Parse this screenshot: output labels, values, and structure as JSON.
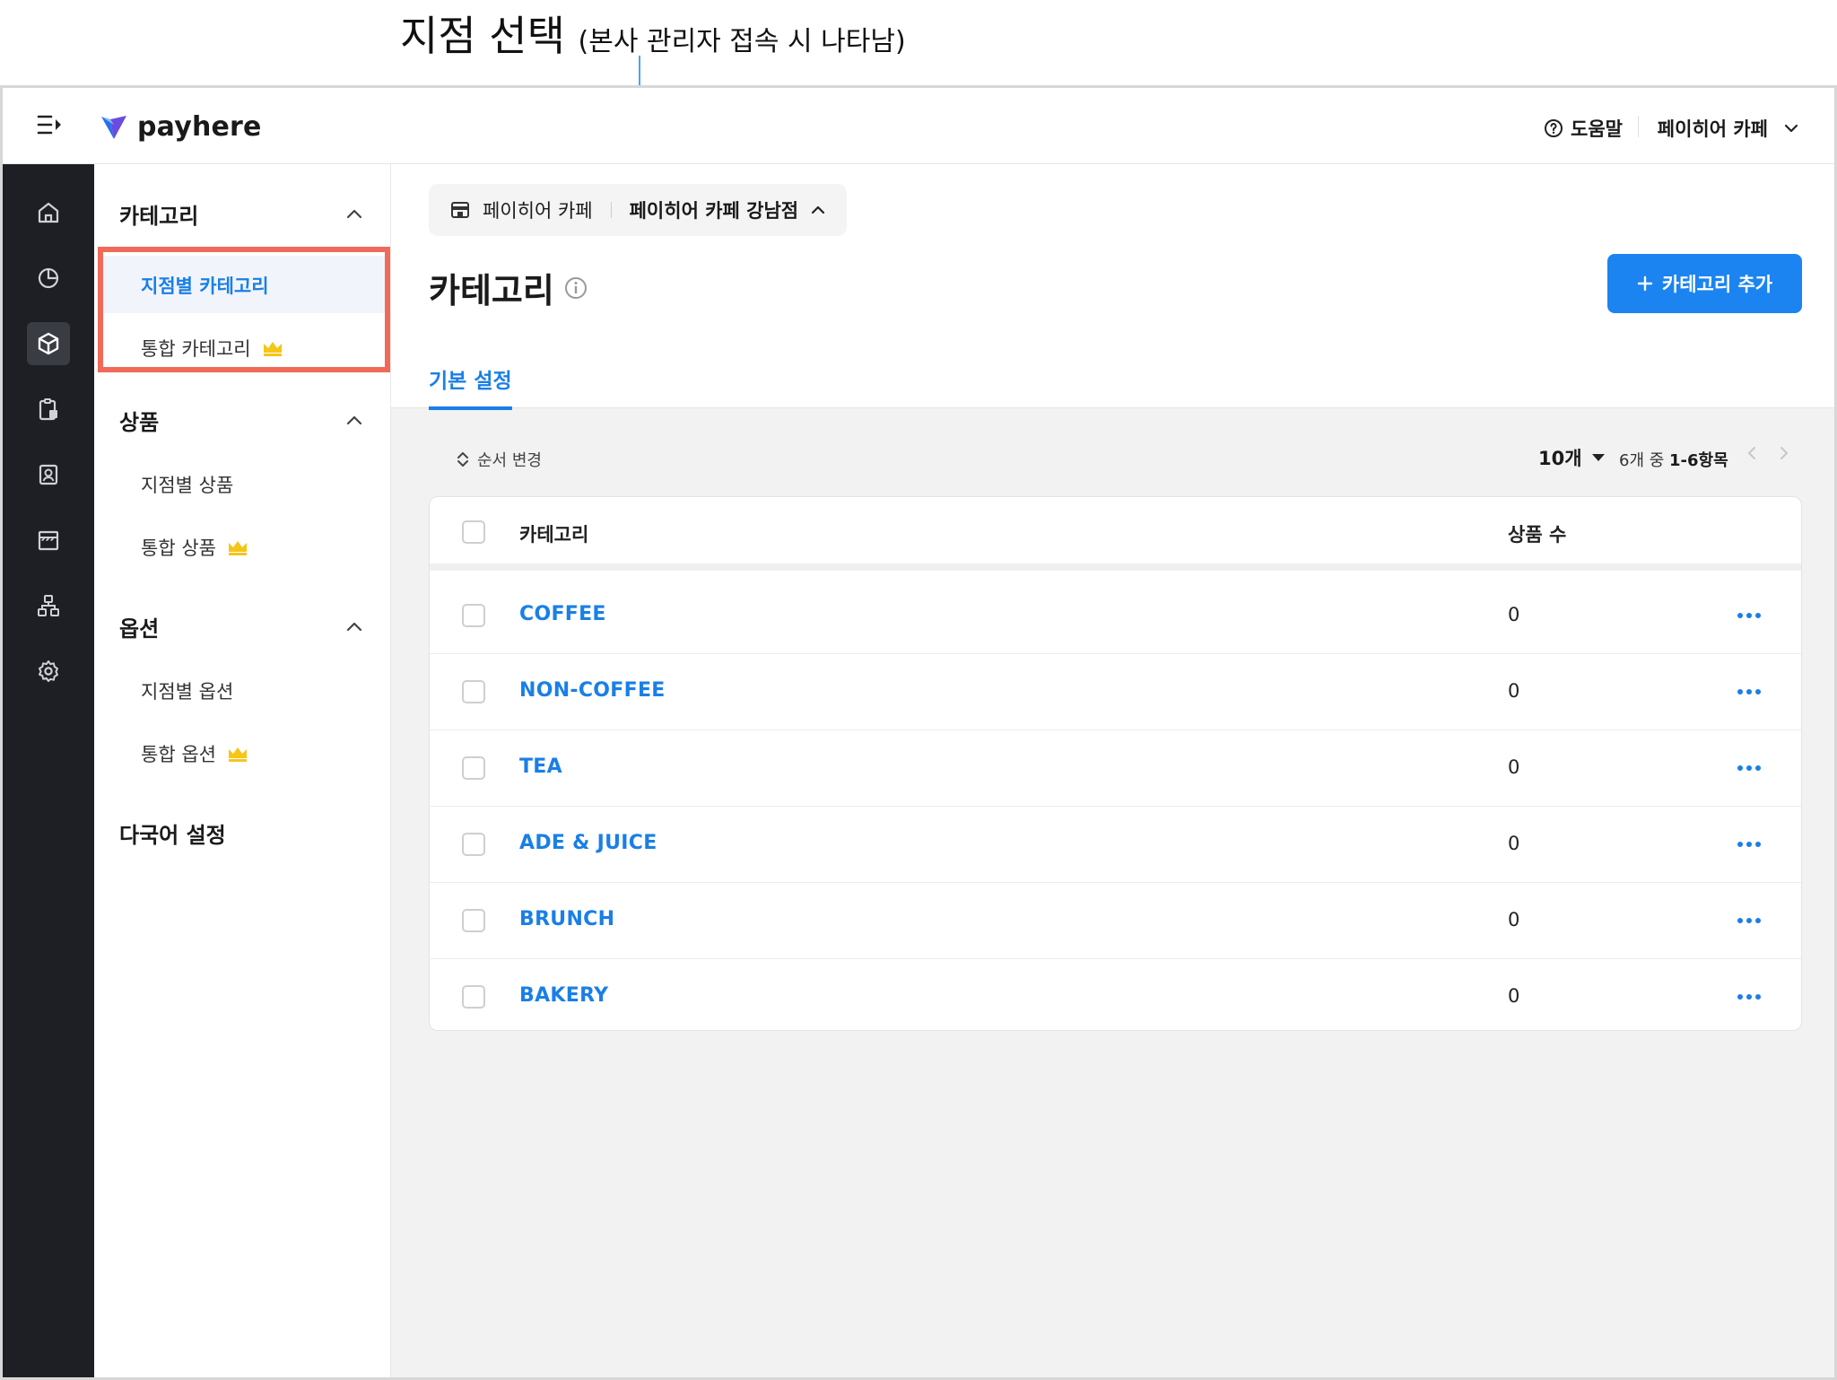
{
  "annotation": {
    "title": "지점 선택",
    "subtitle": "(본사 관리자 접속 시 나타남)"
  },
  "topbar": {
    "logo_text": "payhere",
    "help_label": "도움말",
    "account_label": "페이히어 카페",
    "icons": [
      "menu-collapse-icon",
      "help-circle-icon",
      "chevron-down-icon"
    ]
  },
  "rail": {
    "icons": [
      "home-icon",
      "chart-pie-icon",
      "box-icon",
      "clipboard-icon",
      "user-card-icon",
      "store-icon",
      "hierarchy-icon",
      "gear-icon"
    ],
    "active_index": 2
  },
  "subnav": {
    "sections": [
      {
        "title": "카테고리",
        "items": [
          {
            "label": "지점별 카테고리",
            "active": true
          },
          {
            "label": "통합 카테고리",
            "crown": true
          }
        ]
      },
      {
        "title": "상품",
        "items": [
          {
            "label": "지점별 상품"
          },
          {
            "label": "통합 상품",
            "crown": true
          }
        ]
      },
      {
        "title": "옵션",
        "items": [
          {
            "label": "지점별 옵션"
          },
          {
            "label": "통합 옵션",
            "crown": true
          }
        ]
      }
    ],
    "extra": "다국어 설정"
  },
  "branch_selector": {
    "brand": "페이히어 카페",
    "current": "페이히어 카페 강남점"
  },
  "page": {
    "title": "카테고리",
    "add_button": "카테고리 추가",
    "tab": "기본 설정"
  },
  "toolbar": {
    "reorder_label": "순서 변경",
    "per_page": "10개",
    "range_prefix": "6개 중",
    "range_value": "1-6항목"
  },
  "table": {
    "columns": [
      "카테고리",
      "상품 수"
    ],
    "rows": [
      {
        "name": "COFFEE",
        "count": "0"
      },
      {
        "name": "NON-COFFEE",
        "count": "0"
      },
      {
        "name": "TEA",
        "count": "0"
      },
      {
        "name": "ADE & JUICE",
        "count": "0"
      },
      {
        "name": "BRUNCH",
        "count": "0"
      },
      {
        "name": "BAKERY",
        "count": "0"
      }
    ]
  },
  "colors": {
    "accent": "#1b84f0",
    "rail_bg": "#1e1f24",
    "highlight": "#f06a5a",
    "crown": "#f5c518",
    "annotation": "#4aa3f0"
  }
}
